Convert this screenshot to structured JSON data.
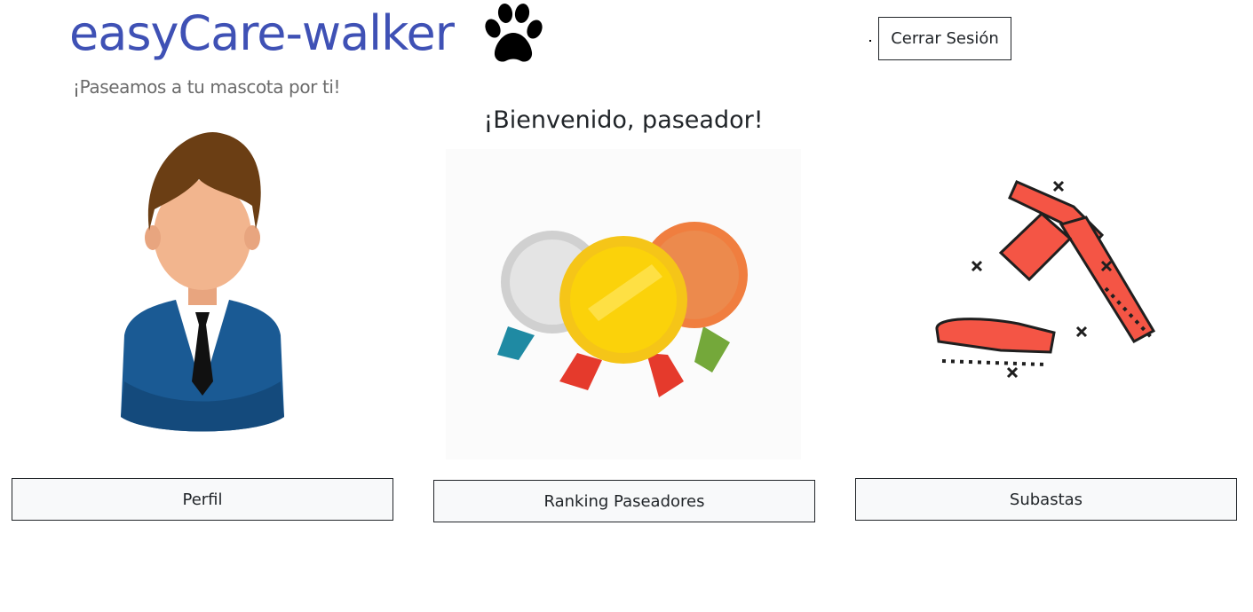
{
  "header": {
    "brand": "easyCare-walker",
    "tagline": "¡Paseamos a tu mascota por ti!",
    "logout_label": "Cerrar Sesión"
  },
  "main": {
    "welcome": "¡Bienvenido, paseador!",
    "cards": [
      {
        "label": "Perfil",
        "image": "user-avatar-illustration"
      },
      {
        "label": "Ranking Paseadores",
        "image": "medals-illustration"
      },
      {
        "label": "Subastas",
        "image": "gavel-illustration"
      }
    ]
  },
  "colors": {
    "brand": "#3f51b5",
    "button_bg": "#f8f9fa",
    "text": "#212529"
  }
}
